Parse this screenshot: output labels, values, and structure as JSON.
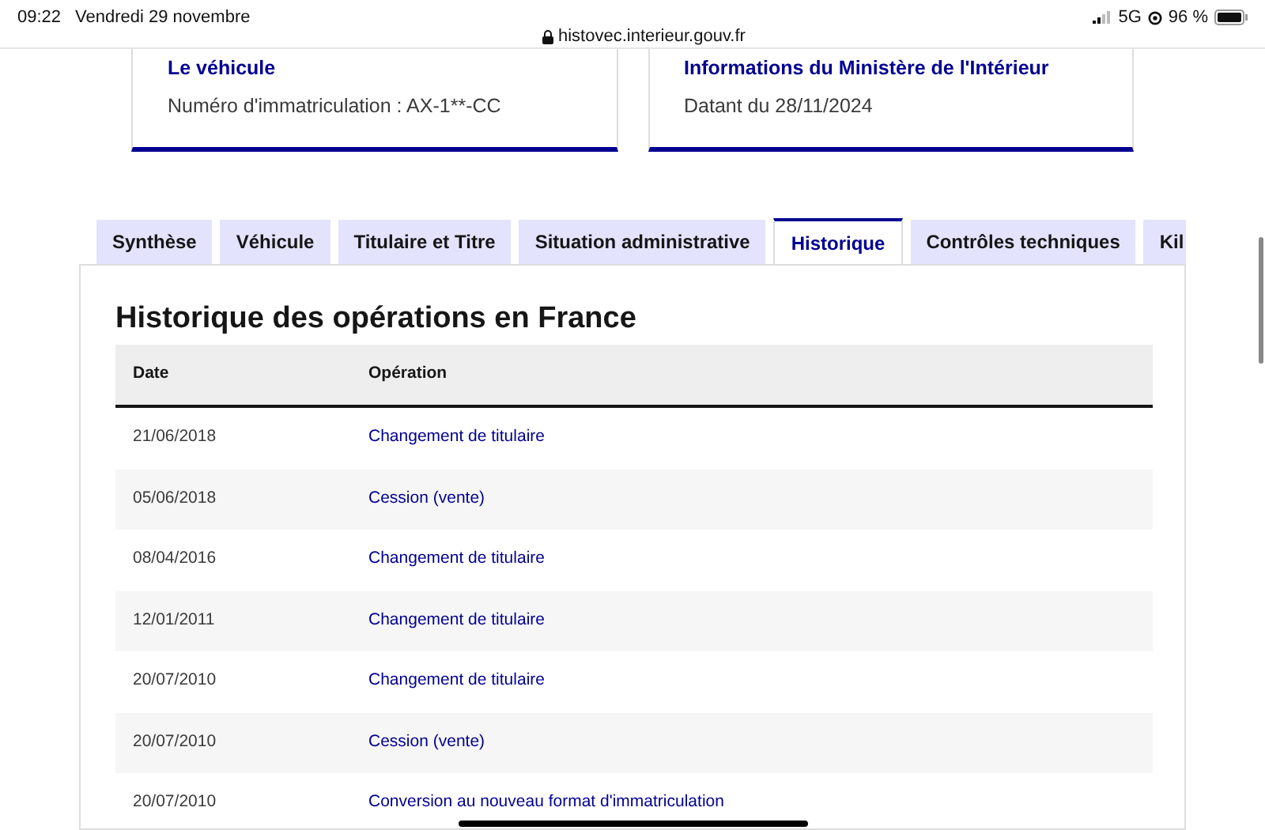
{
  "status_bar": {
    "time": "09:22",
    "date": "Vendredi 29 novembre",
    "url": "histovec.interieur.gouv.fr",
    "network": "5G",
    "battery": "96 %"
  },
  "cards": [
    {
      "title": "Le véhicule",
      "text": "Numéro d'immatriculation : AX-1**-CC"
    },
    {
      "title": "Informations du Ministère de l'Intérieur",
      "text": "Datant du 28/11/2024"
    }
  ],
  "tabs": [
    {
      "label": "Synthèse",
      "selected": false
    },
    {
      "label": "Véhicule",
      "selected": false
    },
    {
      "label": "Titulaire et Titre",
      "selected": false
    },
    {
      "label": "Situation administrative",
      "selected": false
    },
    {
      "label": "Historique",
      "selected": true
    },
    {
      "label": "Contrôles techniques",
      "selected": false
    },
    {
      "label": "Kil",
      "selected": false
    }
  ],
  "heading": "Historique des opérations en France",
  "table": {
    "columns": [
      "Date",
      "Opération"
    ],
    "rows": [
      [
        "21/06/2018",
        "Changement de titulaire"
      ],
      [
        "05/06/2018",
        "Cession (vente)"
      ],
      [
        "08/04/2016",
        "Changement de titulaire"
      ],
      [
        "12/01/2011",
        "Changement de titulaire"
      ],
      [
        "20/07/2010",
        "Changement de titulaire"
      ],
      [
        "20/07/2010",
        "Cession (vente)"
      ],
      [
        "20/07/2010",
        "Conversion au nouveau format d'immatriculation"
      ]
    ]
  }
}
